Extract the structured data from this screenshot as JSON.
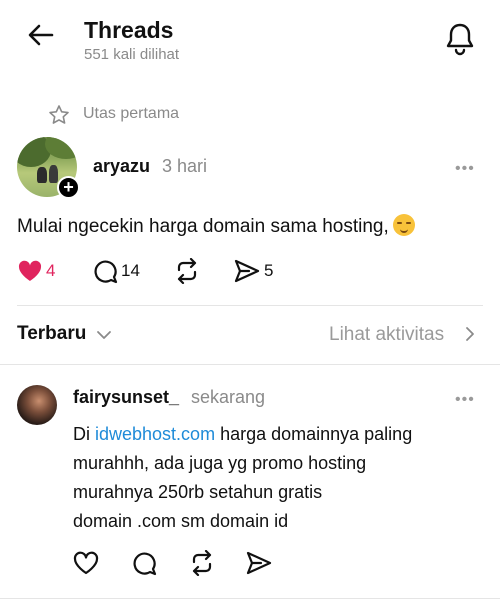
{
  "header": {
    "title": "Threads",
    "views": "551 kali dilihat"
  },
  "pinned": {
    "label": "Utas pertama"
  },
  "post": {
    "author": "aryazu",
    "time": "3 hari",
    "text": "Mulai ngecekin harga domain sama hosting,",
    "likes": "4",
    "replies": "14",
    "shares": "5"
  },
  "sort": {
    "label": "Terbaru",
    "activity": "Lihat aktivitas"
  },
  "comment": {
    "author": "fairysunset_",
    "time": "sekarang",
    "text_prefix": "Di ",
    "link": "idwebhost.com",
    "text_line1_rest": " harga domainnya paling",
    "text_line2": "murahhh, ada juga yg promo hosting",
    "text_line3": "murahnya 250rb setahun gratis",
    "text_line4": "domain .com sm domain id"
  },
  "colors": {
    "like_active": "#e0245e",
    "link": "#1f8bd8",
    "muted": "#8a8a8a"
  },
  "icons": [
    "back-arrow-icon",
    "bell-icon",
    "star-icon",
    "heart-icon",
    "comment-icon",
    "repost-icon",
    "send-icon",
    "chevron-down-icon",
    "chevron-right-icon",
    "more-icon"
  ]
}
